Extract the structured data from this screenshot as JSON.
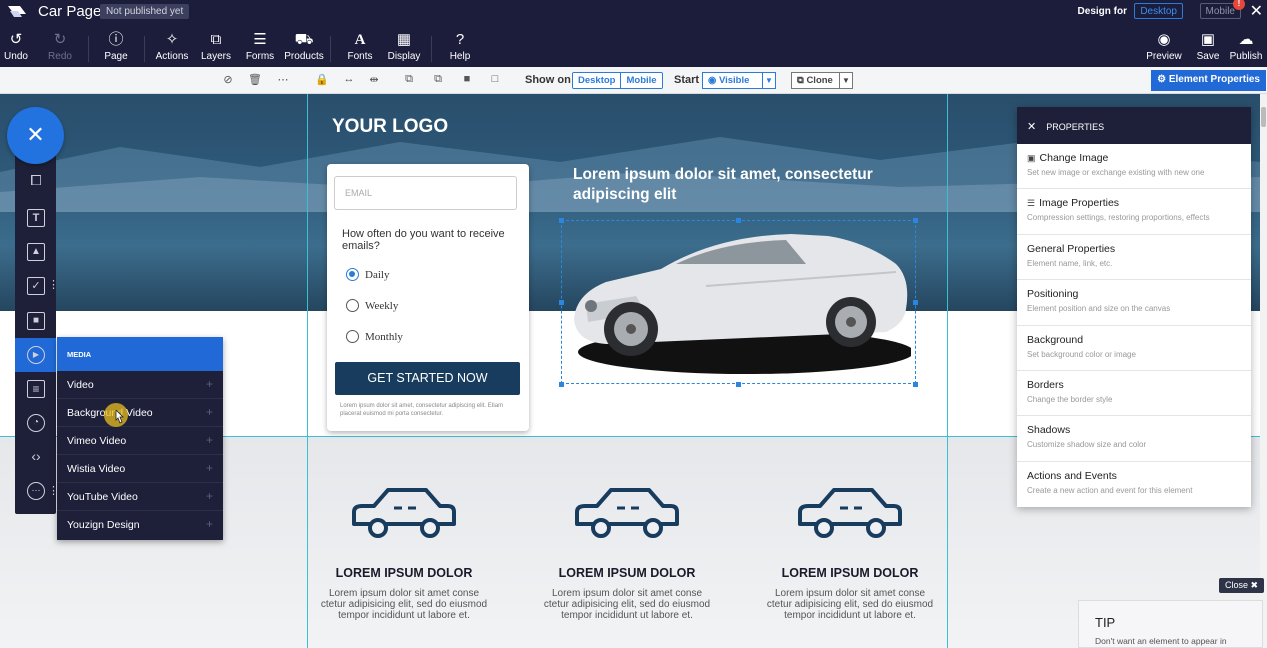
{
  "app": {
    "page_title": "Car Page",
    "publish_status": "Not published yet",
    "design_for_label": "Design for",
    "device_desktop": "Desktop",
    "device_mobile": "Mobile",
    "notification_count": "!"
  },
  "toolbar": {
    "left": [
      {
        "label": "Undo",
        "icon": "undo-icon"
      },
      {
        "label": "Redo",
        "icon": "redo-icon"
      },
      {
        "label": "Page",
        "icon": "info-icon"
      },
      {
        "label": "Actions",
        "icon": "magic-wand-icon"
      },
      {
        "label": "Layers",
        "icon": "layers-icon"
      },
      {
        "label": "Forms",
        "icon": "form-icon"
      },
      {
        "label": "Products",
        "icon": "cart-icon"
      },
      {
        "label": "Fonts",
        "icon": "font-icon"
      },
      {
        "label": "Display",
        "icon": "grid-icon"
      },
      {
        "label": "Help",
        "icon": "help-icon"
      }
    ],
    "right": [
      {
        "label": "Preview",
        "icon": "eye-icon"
      },
      {
        "label": "Save",
        "icon": "save-icon"
      },
      {
        "label": "Publish",
        "icon": "cloud-upload-icon"
      }
    ]
  },
  "subbar": {
    "show_on_label": "Show on",
    "show_desktop": "Desktop",
    "show_mobile": "Mobile",
    "start_label": "Start",
    "visible_option": "Visible",
    "clone_option": "Clone",
    "element_properties": "Element Properties"
  },
  "canvas": {
    "site_logo": "YOUR LOGO",
    "form": {
      "email_placeholder": "EMAIL",
      "question": "How often do you want to receive emails?",
      "options": [
        "Daily",
        "Weekly",
        "Monthly"
      ],
      "selected": "Daily",
      "cta": "GET STARTED NOW",
      "fine_print": "Lorem ipsum dolor sit amet, consectetur adipiscing elit. Etiam placerat euismod mi porta consectetur."
    },
    "headline": "Lorem ipsum dolor sit amet, consectetur adipiscing elit",
    "features": [
      {
        "title": "LOREM IPSUM DOLOR",
        "desc": "Lorem ipsum dolor sit amet conse ctetur adipisicing elit, sed do eiusmod tempor incididunt ut labore et."
      },
      {
        "title": "LOREM IPSUM DOLOR",
        "desc": "Lorem ipsum dolor sit amet conse ctetur adipisicing elit, sed do eiusmod tempor incididunt ut labore et."
      },
      {
        "title": "LOREM IPSUM DOLOR",
        "desc": "Lorem ipsum dolor sit amet conse ctetur adipisicing elit, sed do eiusmod tempor incididunt ut labore et."
      }
    ]
  },
  "media_menu": {
    "header": "MEDIA",
    "items": [
      "Video",
      "Background Video",
      "Vimeo Video",
      "Wistia Video",
      "YouTube Video",
      "Youzign Design"
    ]
  },
  "properties": {
    "header": "PROPERTIES",
    "items": [
      {
        "title": "Change Image",
        "desc": "Set new image or exchange existing with new one"
      },
      {
        "title": "Image Properties",
        "desc": "Compression settings, restoring proportions, effects"
      },
      {
        "title": "General Properties",
        "desc": "Element name, link, etc."
      },
      {
        "title": "Positioning",
        "desc": "Element position and size on the canvas"
      },
      {
        "title": "Background",
        "desc": "Set background color or image"
      },
      {
        "title": "Borders",
        "desc": "Change the border style"
      },
      {
        "title": "Shadows",
        "desc": "Customize shadow size and color"
      },
      {
        "title": "Actions and Events",
        "desc": "Create a new action and event for this element"
      }
    ]
  },
  "tip": {
    "close_label": "Close",
    "title": "TIP",
    "text": "Don't want an element to appear in"
  }
}
